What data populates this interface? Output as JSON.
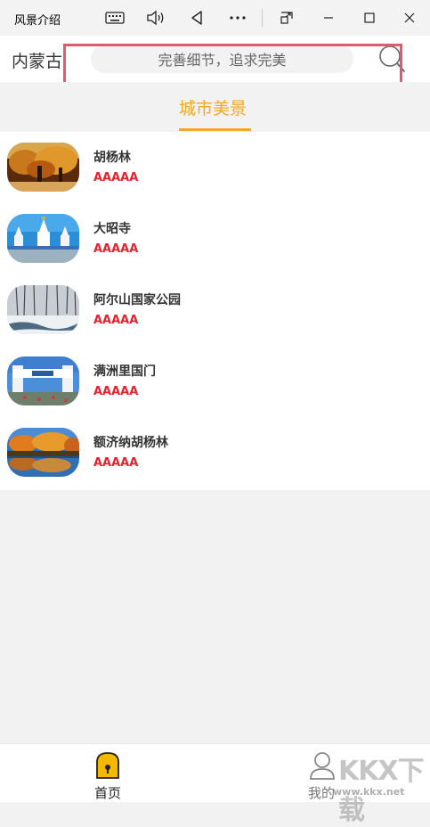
{
  "window": {
    "title": "风景介绍",
    "controls": [
      "keyboard-icon",
      "volume-icon",
      "back-icon",
      "more-icon",
      "compact-overlay-icon",
      "minimize-icon",
      "maximize-icon",
      "close-icon"
    ]
  },
  "header": {
    "city": "内蒙古",
    "search_placeholder": "完善细节，追求完美"
  },
  "tabs": [
    {
      "label": "城市美景",
      "active": true
    }
  ],
  "spots": [
    {
      "name": "胡杨林",
      "rating": "AAAAA",
      "thumb": "autumn-populus-forest"
    },
    {
      "name": "大昭寺",
      "rating": "AAAAA",
      "thumb": "temple-stupas"
    },
    {
      "name": "阿尔山国家公园",
      "rating": "AAAAA",
      "thumb": "snowy-forest-stream"
    },
    {
      "name": "满洲里国门",
      "rating": "AAAAA",
      "thumb": "national-gate"
    },
    {
      "name": "额济纳胡杨林",
      "rating": "AAAAA",
      "thumb": "autumn-lake-reflection"
    }
  ],
  "bottom_nav": {
    "home": "首页",
    "mine": "我的"
  },
  "watermark": {
    "logo": "KKX下载",
    "url": "www.kkx.net"
  },
  "colors": {
    "accent": "#f5a623",
    "rating": "#e8212d",
    "highlight_frame": "#e25b6a"
  }
}
